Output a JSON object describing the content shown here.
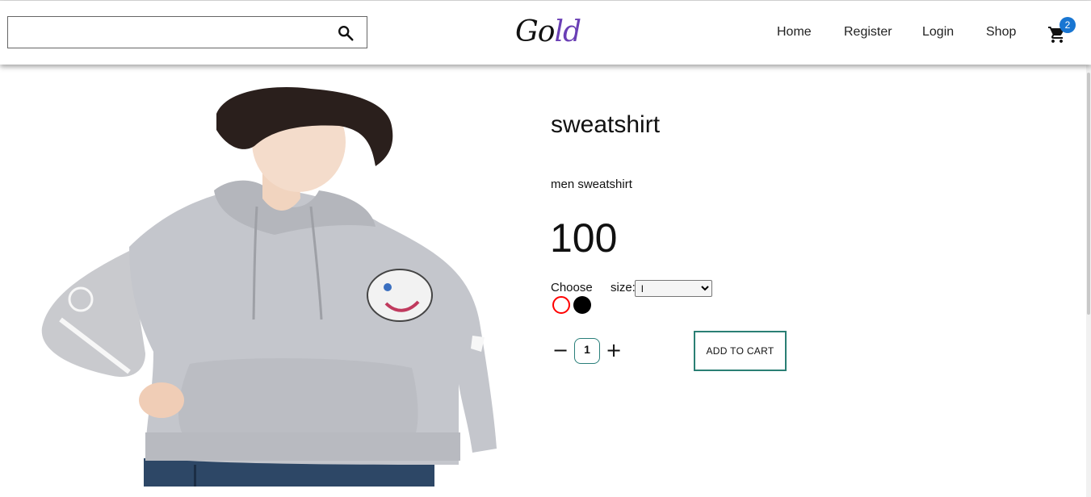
{
  "header": {
    "search": {
      "value": "",
      "placeholder": ""
    },
    "logo": {
      "main": "Go",
      "accent": "ld"
    },
    "nav": [
      "Home",
      "Register",
      "Login",
      "Shop"
    ],
    "cart_count": "2"
  },
  "product": {
    "title": "sweatshirt",
    "description": "men sweatshirt",
    "price": "100",
    "choose_label": "Choose",
    "size_label": "size:",
    "size_selected": "l",
    "colors": [
      "#ff0000",
      "#000000"
    ],
    "quantity": "1",
    "minus_label": "−",
    "plus_label": "+",
    "add_to_cart_label": "ADD TO CART"
  },
  "colors": {
    "cart_badge": "#1976d2",
    "accent_teal": "#2a7f74",
    "logo_accent": "#6a3fb5"
  }
}
